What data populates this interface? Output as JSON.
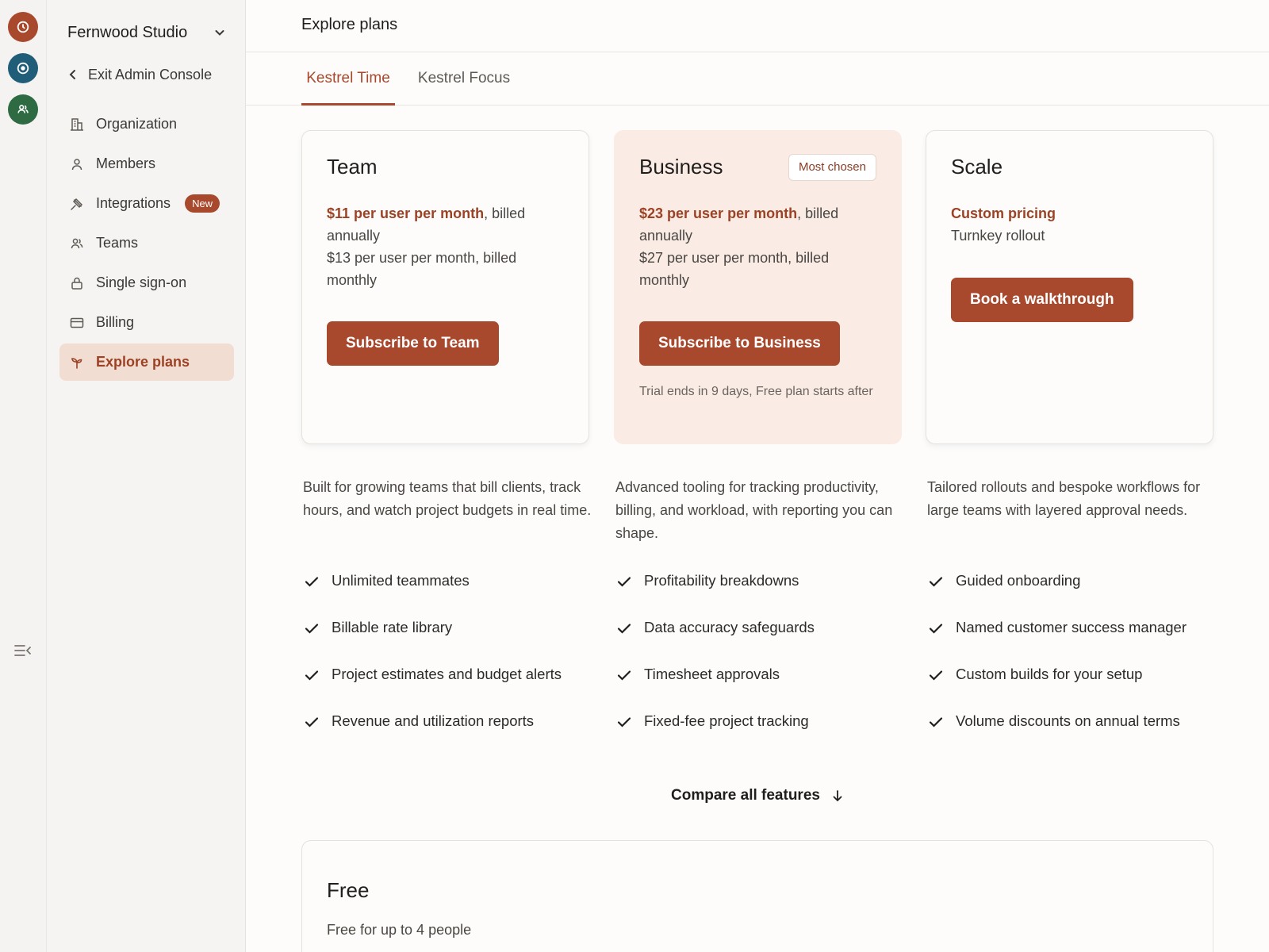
{
  "rail": {
    "apps": [
      {
        "icon": "clock-icon",
        "color": "#a8482c"
      },
      {
        "icon": "target-icon",
        "color": "#1f5d78"
      },
      {
        "icon": "people-icon",
        "color": "#2e6b43"
      }
    ],
    "collapse_icon": "collapse-sidebar-icon"
  },
  "sidebar": {
    "org_name": "Fernwood Studio",
    "exit_label": "Exit Admin Console",
    "items": [
      {
        "label": "Organization",
        "icon": "building-icon"
      },
      {
        "label": "Members",
        "icon": "person-icon"
      },
      {
        "label": "Integrations",
        "icon": "plug-icon",
        "badge": "New"
      },
      {
        "label": "Teams",
        "icon": "people-icon"
      },
      {
        "label": "Single sign-on",
        "icon": "lock-icon"
      },
      {
        "label": "Billing",
        "icon": "card-icon"
      },
      {
        "label": "Explore plans",
        "icon": "sprout-icon",
        "active": true
      }
    ]
  },
  "header": {
    "title": "Explore plans"
  },
  "tabs": [
    {
      "label": "Kestrel Time",
      "active": true
    },
    {
      "label": "Kestrel Focus",
      "active": false
    }
  ],
  "plans": [
    {
      "name": "Team",
      "price_highlight": "$11 per user per month",
      "price_rest": ", billed annually",
      "price_secondary": "$13 per user per month, billed monthly",
      "cta": "Subscribe to Team",
      "description": "Built for growing teams that bill clients, track hours, and watch project budgets in real time.",
      "features": [
        "Unlimited teammates",
        "Billable rate library",
        "Project estimates and budget alerts",
        "Revenue and utilization reports"
      ]
    },
    {
      "name": "Business",
      "badge": "Most chosen",
      "price_highlight": "$23 per user per month",
      "price_rest": ", billed annually",
      "price_secondary": "$27 per user per month, billed monthly",
      "cta": "Subscribe to Business",
      "note": "Trial ends in 9 days, Free plan starts after",
      "description": "Advanced tooling for tracking productivity, billing, and workload, with reporting you can shape.",
      "features": [
        "Profitability breakdowns",
        "Data accuracy safeguards",
        "Timesheet approvals",
        "Fixed-fee project tracking"
      ]
    },
    {
      "name": "Scale",
      "price_highlight": "Custom pricing",
      "price_secondary": "Turnkey rollout",
      "cta": "Book a walkthrough",
      "description": "Tailored rollouts and bespoke workflows for large teams with layered approval needs.",
      "features": [
        "Guided onboarding",
        "Named customer success manager",
        "Custom builds for your setup",
        "Volume discounts on annual terms"
      ]
    }
  ],
  "compare_label": "Compare all features",
  "free_plan": {
    "name": "Free",
    "subtitle": "Free for up to 4 people"
  },
  "colors": {
    "accent": "#a8482c",
    "accent_soft": "#f2ddd3",
    "highlight_card": "#faece5"
  }
}
